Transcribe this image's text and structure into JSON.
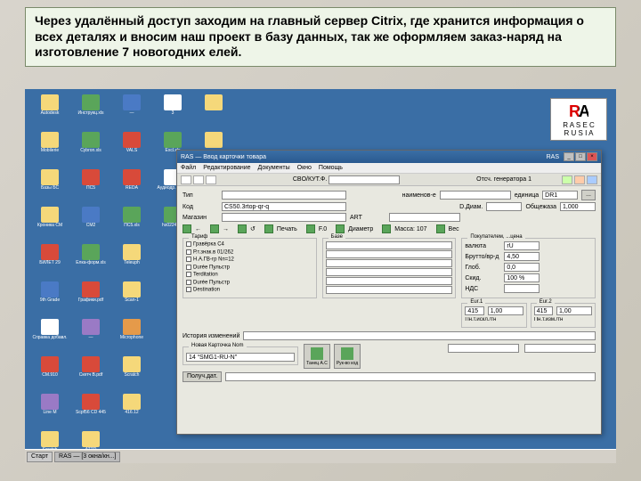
{
  "caption": "Через удалённый доступ заходим на главный сервер Citrix, где хранится информация о всех деталях и вносим наш проект в базу данных, так же оформляем заказ-наряд на изготовление 7 новогодних елей.",
  "logo": {
    "initials": "RA",
    "sub": "R A S E C",
    "sub2": "R U S I A"
  },
  "desktop_icons": [
    {
      "label": "Autodesk",
      "c": "c-folder"
    },
    {
      "label": "Инструкц.xls",
      "c": "c-xls"
    },
    {
      "label": "—",
      "c": "c-doc"
    },
    {
      "label": "3",
      "c": "c-white"
    },
    {
      "label": "",
      "c": "c-folder"
    },
    {
      "label": "Mobilerie",
      "c": "c-folder"
    },
    {
      "label": "Cybron.xls",
      "c": "c-xls"
    },
    {
      "label": "VALS",
      "c": "c-pdf"
    },
    {
      "label": "Еxcl.xls",
      "c": "c-xls"
    },
    {
      "label": "",
      "c": "c-folder"
    },
    {
      "label": "Базы БС",
      "c": "c-folder"
    },
    {
      "label": "ПС5",
      "c": "c-pdf"
    },
    {
      "label": "REDA",
      "c": "c-pdf"
    },
    {
      "label": "Аудиодр.1.mp3",
      "c": "c-white"
    },
    {
      "label": "",
      "c": "c-folder"
    },
    {
      "label": "Кроника CM",
      "c": "c-folder"
    },
    {
      "label": "CM2",
      "c": "c-doc"
    },
    {
      "label": "ПС5.xls",
      "c": "c-xls"
    },
    {
      "label": "hs0224.xls",
      "c": "c-xls"
    },
    {
      "label": "",
      "c": "c-folder"
    },
    {
      "label": "БИЛЕТ 29",
      "c": "c-pdf"
    },
    {
      "label": "Елка-форм.xls",
      "c": "c-xls"
    },
    {
      "label": "Teleuph",
      "c": "c-folder"
    },
    {
      "label": "",
      "c": ""
    },
    {
      "label": "",
      "c": ""
    },
    {
      "label": "9th Grade",
      "c": "c-doc"
    },
    {
      "label": "Графики.pdf",
      "c": "c-pdf"
    },
    {
      "label": "Scan-1",
      "c": "c-folder"
    },
    {
      "label": "",
      "c": ""
    },
    {
      "label": "",
      "c": ""
    },
    {
      "label": "Справка добавл.",
      "c": "c-white"
    },
    {
      "label": "—",
      "c": "c-app"
    },
    {
      "label": "Microphone",
      "c": "c-orange"
    },
    {
      "label": "",
      "c": ""
    },
    {
      "label": "",
      "c": ""
    },
    {
      "label": "CM.910",
      "c": "c-pdf"
    },
    {
      "label": "Скетч В.pdf",
      "c": "c-pdf"
    },
    {
      "label": "Scratch",
      "c": "c-folder"
    },
    {
      "label": "",
      "c": ""
    },
    {
      "label": "",
      "c": ""
    },
    {
      "label": "Line M",
      "c": "c-app"
    },
    {
      "label": "Scpf56 CD 445",
      "c": "c-pdf"
    },
    {
      "label": "416.12",
      "c": "c-folder"
    },
    {
      "label": "",
      "c": ""
    },
    {
      "label": "",
      "c": ""
    },
    {
      "label": "Scratch",
      "c": "c-folder"
    },
    {
      "label": "ATTD",
      "c": "c-folder"
    },
    {
      "label": "",
      "c": ""
    },
    {
      "label": "",
      "c": ""
    },
    {
      "label": "",
      "c": ""
    }
  ],
  "window": {
    "title": "RAS — Ввод карточки товара",
    "right_title": "RAS",
    "menu": [
      "Файл",
      "Редактирование",
      "Документы",
      "Окно",
      "Помощь"
    ],
    "header_fields": {
      "type_label": "Тип",
      "code_label": "Код",
      "code_value": "CS50.3rtop-qr-q",
      "naim_label": "наименов-е",
      "cbo_label": "CBO/КУТ.Ф.",
      "status_label": "Отсч. генератора  1",
      "ed_label": "единица",
      "ed_value": "DR1",
      "dia_label": "D.Диам.",
      "size_label": "Общежаза",
      "size_value": "1,000",
      "mag_label": "Магазин",
      "art_label": "ART"
    },
    "nav_buttons": [
      "←",
      "→",
      "↺",
      "Печать",
      "F.0",
      "Диаметр",
      "Масса: 107",
      "Вес"
    ],
    "section_labels": {
      "tarif": "Тариф",
      "base": "Базе",
      "pokupka": "Покупателем, ...цена",
      "size1": "Eur.1",
      "size2": "Eur.2"
    },
    "tarif_lines": [
      "Гравёрка C4",
      "Р.т.знак.в 01/262",
      "Н.А.ГВ-гр  Nп=12",
      "Durée Пульстр",
      "Terditation",
      "Durée Пульстр",
      "Destination"
    ],
    "pokupka": {
      "valuta_label": "валюта",
      "valuta_value": "rU",
      "brut_label": "Брутто/вр-д",
      "brut_value": "4,50",
      "glob_label": "Глоб.",
      "glob_value": "0,0",
      "skid_label": "Скид.",
      "skid_value": "100 %",
      "nds_label": "НДС",
      "nds_value": ""
    },
    "size1": {
      "f1": "415 km",
      "f2": "1,00"
    },
    "size2": {
      "f1": "415 km",
      "f2": "1,00"
    },
    "pay_labels": {
      "p1": "Пн.т.искл./тн",
      "p2": "Пн.т.изм./тн"
    },
    "history_label": "История изменений",
    "kod_box": {
      "title": "Новая Карточка Nom",
      "value": "14 “SMG1-RU-N”"
    },
    "footer_btn": "Получ.дат."
  },
  "bottom_buttons": [
    {
      "label": "Танец А.С"
    },
    {
      "label": "Рук-во код"
    }
  ],
  "taskbar": {
    "start": "Старт",
    "task": "RAS — [3 окна/кн...]"
  }
}
